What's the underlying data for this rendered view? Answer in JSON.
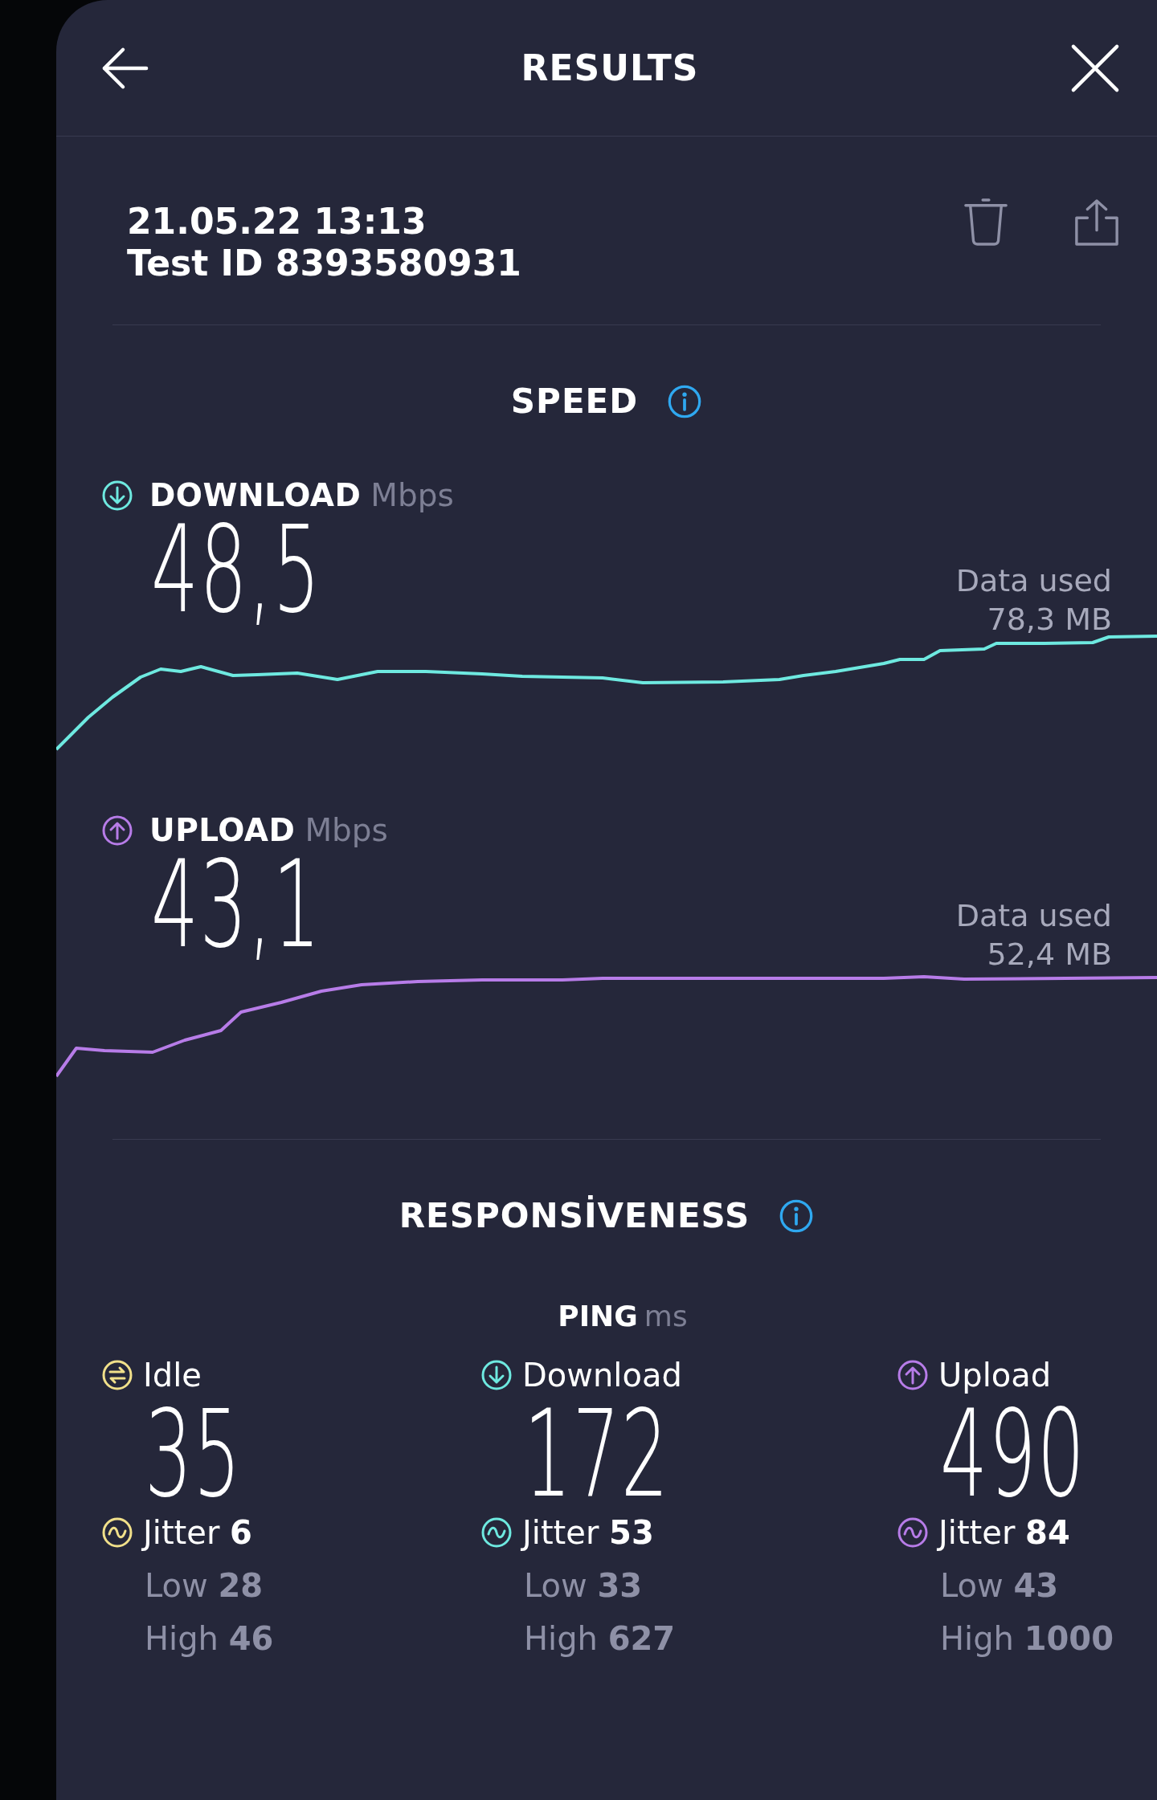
{
  "header": {
    "title": "RESULTS"
  },
  "test": {
    "date": "21.05.22 13:13",
    "test_id": "Test ID 8393580931"
  },
  "speed": {
    "title": "SPEED",
    "results": [
      {
        "kind": "download",
        "label": "DOWNLOAD",
        "unit": "Mbps",
        "value": "48,5",
        "data_used_label": "Data used",
        "data_used": "78,3 MB",
        "color": "#6ee9e0"
      },
      {
        "kind": "upload",
        "label": "UPLOAD",
        "unit": "Mbps",
        "value": "43,1",
        "data_used_label": "Data used",
        "data_used": "52,4 MB",
        "color": "#b77ce8"
      }
    ]
  },
  "responsiveness": {
    "title": "RESPONSİVENESS",
    "ping_label": "PING",
    "ping_unit": "ms",
    "columns": [
      {
        "kind": "idle",
        "label": "Idle",
        "value": "35",
        "color": "#f1e08a",
        "jitter_label": "Jitter",
        "jitter": "6",
        "low_label": "Low",
        "low": "28",
        "high_label": "High",
        "high": "46"
      },
      {
        "kind": "download",
        "label": "Download",
        "value": "172",
        "color": "#6ee9e0",
        "jitter_label": "Jitter",
        "jitter": "53",
        "low_label": "Low",
        "low": "33",
        "high_label": "High",
        "high": "627"
      },
      {
        "kind": "upload",
        "label": "Upload",
        "value": "490",
        "color": "#b77ce8",
        "jitter_label": "Jitter",
        "jitter": "84",
        "low_label": "Low",
        "low": "43",
        "high_label": "High",
        "high": "1000"
      }
    ]
  }
}
